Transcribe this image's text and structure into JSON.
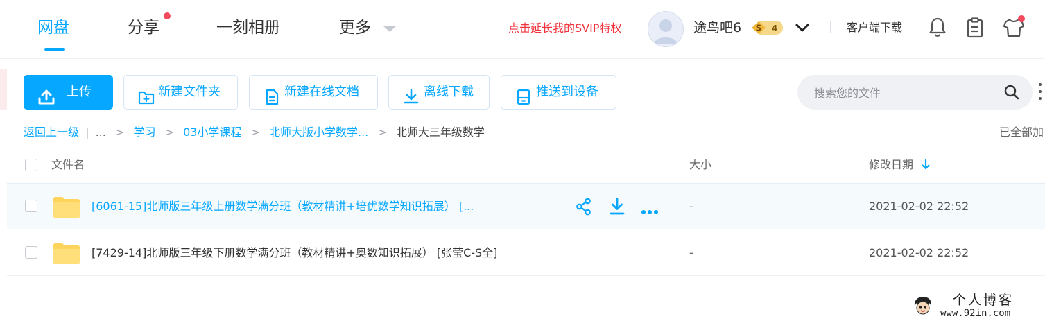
{
  "nav": {
    "tabs": [
      {
        "label": "网盘",
        "active": true
      },
      {
        "label": "分享",
        "has_dot": true
      },
      {
        "label": "一刻相册"
      },
      {
        "label": "更多"
      }
    ],
    "svip_link": "点击延长我的SVIP特权",
    "username": "途鸟吧6",
    "vip_level": "4",
    "vip_badge_letter": "S",
    "client_download": "客户端下载"
  },
  "toolbar": {
    "upload": "上传",
    "new_folder": "新建文件夹",
    "new_online_doc": "新建在线文档",
    "offline_download": "离线下载",
    "push_to_device": "推送到设备",
    "search_placeholder": "搜索您的文件"
  },
  "breadcrumb": {
    "back": "返回上一级",
    "bar": "|",
    "ellipsis": "...",
    "sep": ">",
    "items": [
      "学习",
      "03小学课程",
      "北师大版小学数学..."
    ],
    "current": "北师大三年级数学",
    "loaded_hint": "已全部加"
  },
  "table": {
    "headers": {
      "name": "文件名",
      "size": "大小",
      "date": "修改日期"
    },
    "sort": {
      "column": "date",
      "direction": "desc"
    },
    "rows": [
      {
        "name": "[6061-15]北师版三年级上册数学满分班（教材精讲+培优数学知识拓展）  [...",
        "size": "-",
        "date": "2021-02-02 22:52",
        "hovered": true
      },
      {
        "name": "[7429-14]北师版三年级下册数学满分班（教材精讲+奥数知识拓展）  [张莹C-S全]",
        "size": "-",
        "date": "2021-02-02 22:52",
        "hovered": false
      }
    ]
  },
  "watermark": {
    "title": "个人博客",
    "url": "www.92in.com"
  },
  "colors": {
    "accent": "#06a7ff",
    "svip_red": "#f2323c",
    "dot_red": "#f5495c",
    "folder": "#ffd45c",
    "hover_row": "#f5fafd",
    "vip_gold": "#f5c451"
  },
  "icons": [
    "user-avatar-icon",
    "vip-badge-icon",
    "chevron-down-icon",
    "bell-icon",
    "clipboard-icon",
    "tshirt-icon",
    "upload-icon",
    "folder-plus-icon",
    "document-icon",
    "download-icon",
    "device-icon",
    "search-icon",
    "more-vertical-icon",
    "sort-down-arrow-icon",
    "folder-icon",
    "share-icon",
    "more-horizontal-icon"
  ]
}
